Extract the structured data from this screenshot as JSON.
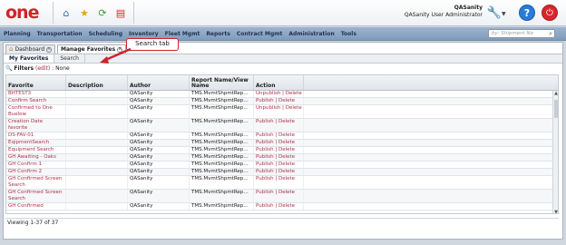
{
  "app": {
    "logo": "one",
    "user_name": "QASanity",
    "user_role": "QASanity User Administrator"
  },
  "quickbar_icons": [
    "home-icon",
    "favorites-star-icon",
    "refresh-icon",
    "report-icon"
  ],
  "nav": {
    "items": [
      "Planning",
      "Transportation",
      "Scheduling",
      "Inventory",
      "Fleet Mgmt",
      "Reports",
      "Contract Mgmt",
      "Administration",
      "Tools"
    ],
    "search_placeholder": "by: Shipment No"
  },
  "tabs": [
    {
      "label": "Dashboard",
      "active": false
    },
    {
      "label": "Manage Favorites",
      "active": true
    }
  ],
  "subtabs": [
    {
      "label": "My Favorites",
      "active": true
    },
    {
      "label": "Search",
      "active": false
    }
  ],
  "filters": {
    "label": "Filters",
    "edit": "(edit)",
    "value": ": None"
  },
  "grid": {
    "columns": [
      "Favorite",
      "Description",
      "Author",
      "Report Name/View Name",
      "Action"
    ],
    "rows": [
      {
        "favorite": "BHTEST3",
        "description": "",
        "author": "QASanity",
        "report": "TMS.MvmtShpmtRepor...",
        "action": "Unpublish | Delete"
      },
      {
        "favorite": "Confirm Search",
        "description": "",
        "author": "QASanity",
        "report": "TMS.MvmtShpmtRepor...",
        "action": "Publish | Delete"
      },
      {
        "favorite": "Confirmed to One Buelow",
        "description": "",
        "author": "QASanity",
        "report": "TMS.MvmtShpmtRepor...",
        "action": "Unpublish | Delete"
      },
      {
        "favorite": "Creation Date favorite",
        "description": "",
        "author": "QASanity",
        "report": "TMS.MvmtShpmtRepor...",
        "action": "Publish | Delete"
      },
      {
        "favorite": "DS-FAV-01",
        "description": "",
        "author": "QASanity",
        "report": "TMS.MvmtShpmtRepor...",
        "action": "Publish | Delete"
      },
      {
        "favorite": "EqipmentSearch",
        "description": "",
        "author": "QASanity",
        "report": "TMS.MvmtShpmtRepor...",
        "action": "Publish | Delete"
      },
      {
        "favorite": "Equipment Search",
        "description": "",
        "author": "QASanity",
        "report": "TMS.MvmtShpmtRepor...",
        "action": "Publish | Delete"
      },
      {
        "favorite": "GH Awaiting - Oaks",
        "description": "",
        "author": "QASanity",
        "report": "TMS.MvmtShpmtRepor...",
        "action": "Publish | Delete"
      },
      {
        "favorite": "GH Confirm 1",
        "description": "",
        "author": "QASanity",
        "report": "TMS.MvmtShpmtRepor...",
        "action": "Publish | Delete"
      },
      {
        "favorite": "GH Confirm 2",
        "description": "",
        "author": "QASanity",
        "report": "TMS.MvmtShpmtRepor...",
        "action": "Publish | Delete"
      },
      {
        "favorite": "GH Confirmed Screen Search",
        "description": "",
        "author": "QASanity",
        "report": "TMS.MvmtShpmtRepor...",
        "action": "Publish | Delete"
      },
      {
        "favorite": "GH Confirmed Screen Search",
        "description": "",
        "author": "QASanity",
        "report": "TMS.MvmtShpmtRepor...",
        "action": "Publish | Delete"
      },
      {
        "favorite": "GH Confirmed",
        "description": "",
        "author": "QASanity",
        "report": "TMS.MvmtShpmtRepor...",
        "action": "Publish | Delete"
      }
    ]
  },
  "footer": {
    "viewing": "Viewing 1-37 of 37"
  },
  "annotation": {
    "label": "Search tab",
    "color": "#d0232c"
  }
}
